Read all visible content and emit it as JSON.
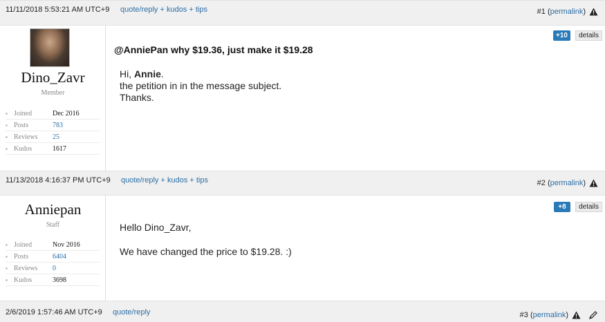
{
  "posts": [
    {
      "date": "11/11/2018 5:53:21 AM UTC+9",
      "actions": "quote/reply + kudos + tips",
      "number": "#1",
      "permalink": "permalink",
      "author": {
        "name": "Dino_Zavr",
        "role": "Member",
        "stats": [
          {
            "label": "Joined",
            "value": "Dec 2016"
          },
          {
            "label": "Posts",
            "value": "783"
          },
          {
            "label": "Reviews",
            "value": "25"
          },
          {
            "label": "Kudos",
            "value": "1617"
          }
        ]
      },
      "kudos": "+10",
      "details": "details",
      "subject": "@AnniePan why $19.36, just make it $19.28",
      "message": {
        "greeting": "Hi, ",
        "greeting_name": "Annie",
        "greeting_end": ".",
        "line2": "the petition in in the message subject.",
        "line3": "Thanks."
      }
    },
    {
      "date": "11/13/2018 4:16:37 PM UTC+9",
      "actions": "quote/reply + kudos + tips",
      "number": "#2",
      "permalink": "permalink",
      "author": {
        "name": "Anniepan",
        "role": "Staff",
        "stats": [
          {
            "label": "Joined",
            "value": "Nov 2016"
          },
          {
            "label": "Posts",
            "value": "6404"
          },
          {
            "label": "Reviews",
            "value": "0"
          },
          {
            "label": "Kudos",
            "value": "3698"
          }
        ]
      },
      "kudos": "+8",
      "details": "details",
      "message": {
        "line1": "Hello Dino_Zavr,",
        "line2": "We have changed the price to $19.28. :)"
      }
    },
    {
      "date": "2/6/2019 1:57:46 AM UTC+9",
      "actions": "quote/reply",
      "number": "#3",
      "permalink": "permalink"
    }
  ],
  "icons": {
    "warning": "warning-icon",
    "edit": "pencil-icon"
  }
}
